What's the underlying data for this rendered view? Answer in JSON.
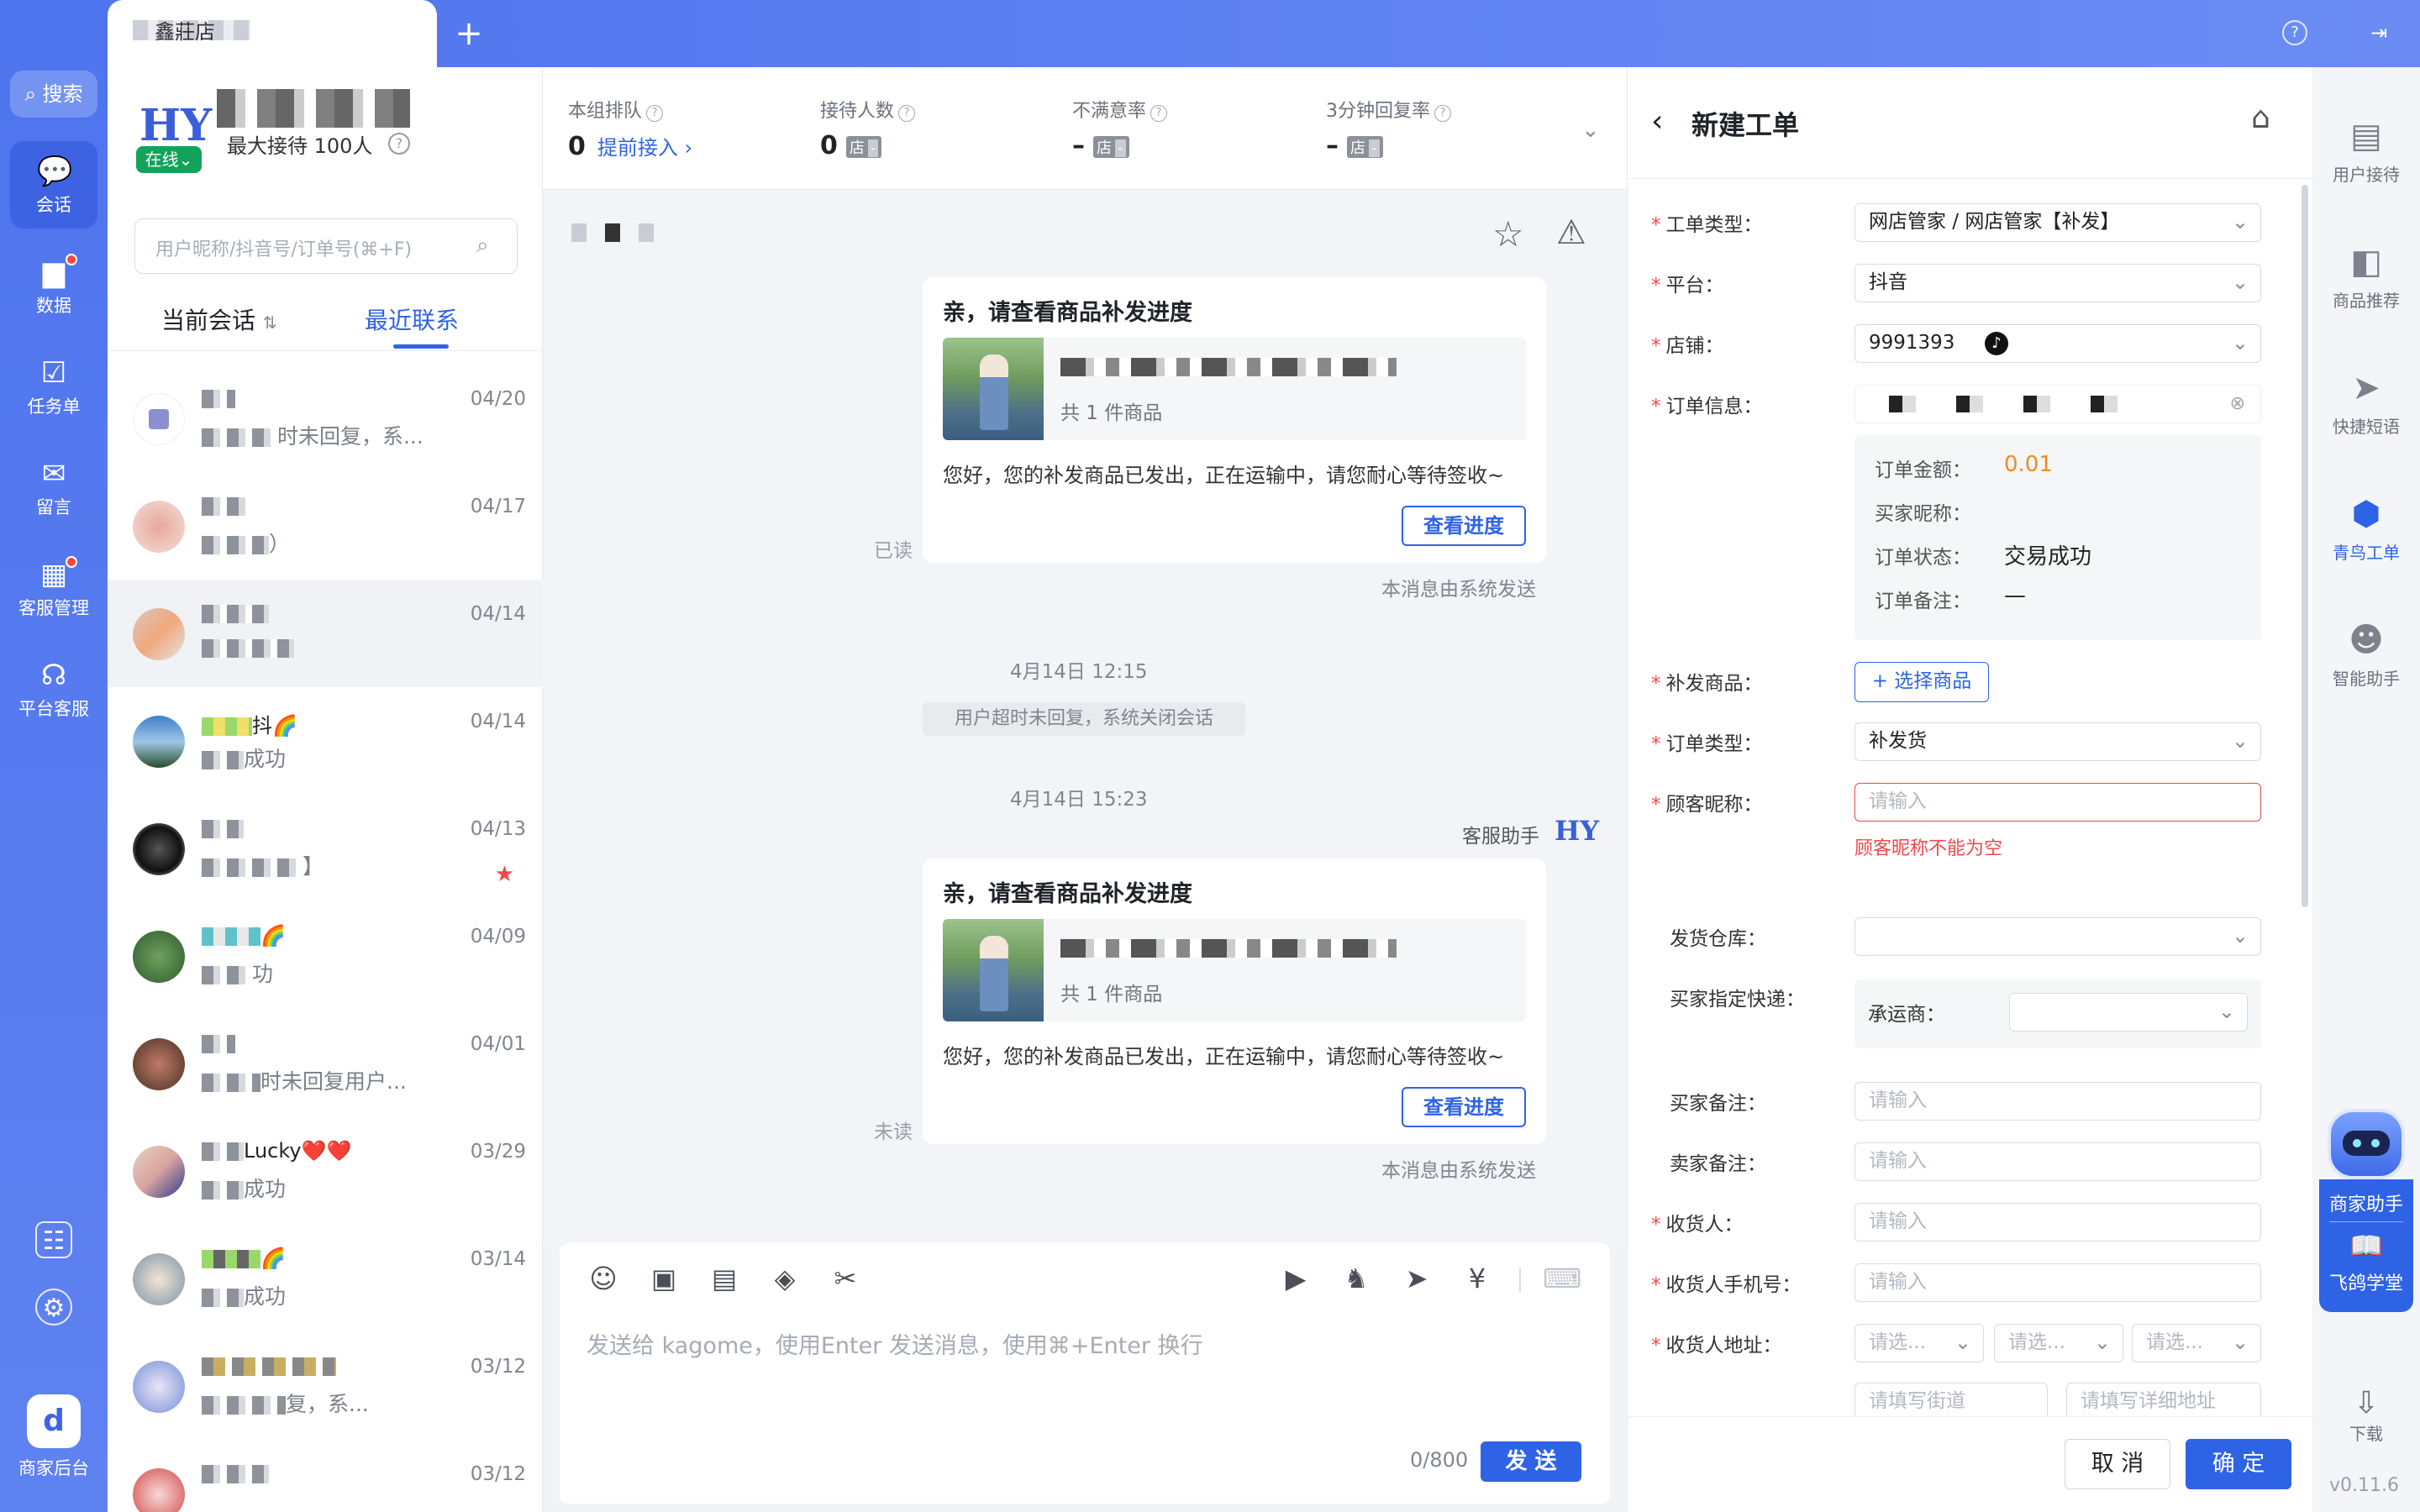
{
  "top_bar": {
    "active_tab_label": "鑫莊店",
    "add_tab_label": "+",
    "help_label": "?"
  },
  "left_nav": {
    "search_label": "搜索",
    "items": [
      {
        "label": "会话",
        "icon": "chat-icon",
        "active": true
      },
      {
        "label": "数据",
        "icon": "bar-chart-icon",
        "badge": true
      },
      {
        "label": "任务单",
        "icon": "task-icon"
      },
      {
        "label": "留言",
        "icon": "mail-icon"
      },
      {
        "label": "客服管理",
        "icon": "apps-icon",
        "badge": true
      },
      {
        "label": "平台客服",
        "icon": "headset-icon"
      }
    ],
    "bottom_label": "商家后台"
  },
  "agent": {
    "status": "在线",
    "max_reception": "最大接待 100人"
  },
  "conv_list": {
    "search_placeholder": "用户昵称/抖音号/订单号(⌘+F)",
    "tab_current": "当前会话",
    "tab_recent": "最近联系",
    "rows": [
      {
        "name": "",
        "preview": "时未回复，系...",
        "date": "04/20"
      },
      {
        "name": "",
        "preview": "）",
        "date": "04/17"
      },
      {
        "name": "",
        "preview": "",
        "date": "04/14",
        "selected": true
      },
      {
        "name": "抖🌈",
        "preview": "成功",
        "date": "04/14"
      },
      {
        "name": "",
        "preview": "】",
        "date": "04/13",
        "flag": true
      },
      {
        "name": "🌈",
        "preview": "功",
        "date": "04/09"
      },
      {
        "name": "",
        "preview": "时未回复用户...",
        "date": "04/01"
      },
      {
        "name": "Lucky❤️❤️",
        "preview": "成功",
        "date": "03/29"
      },
      {
        "name": "🌈",
        "preview": "成功",
        "date": "03/14"
      },
      {
        "name": "",
        "preview": "复，系...",
        "date": "03/12"
      },
      {
        "name": "",
        "preview": "",
        "date": "03/12"
      }
    ]
  },
  "stats": [
    {
      "label": "本组排队",
      "value": "0",
      "link": "提前接入 ›"
    },
    {
      "label": "接待人数",
      "value": "0",
      "badge": "店",
      "badge_d": "-"
    },
    {
      "label": "不满意率",
      "value": "–",
      "badge": "店",
      "badge_d": "-"
    },
    {
      "label": "3分钟回复率",
      "value": "–",
      "badge": "店",
      "badge_d": "-"
    }
  ],
  "chat": {
    "messages": [
      {
        "title": "亲，请查看商品补发进度",
        "count": "共 1 件商品",
        "body": "您好，您的补发商品已发出，正在运输中，请您耐心等待签收~",
        "button": "查看进度",
        "read_state": "已读",
        "sys_note": "本消息由系统发送"
      },
      {
        "title": "亲，请查看商品补发进度",
        "count": "共 1 件商品",
        "body": "您好，您的补发商品已发出，正在运输中，请您耐心等待签收~",
        "button": "查看进度",
        "read_state": "未读",
        "sys_note": "本消息由系统发送"
      }
    ],
    "time1": "4月14日 12:15",
    "system_closed": "用户超时未回复，系统关闭会话",
    "time2": "4月14日 15:23",
    "assistant_label": "客服助手"
  },
  "composer": {
    "placeholder": "发送给 kagome，使用Enter 发送消息，使用⌘+Enter 换行",
    "char_count": "0/800",
    "send": "发 送"
  },
  "work_order": {
    "title": "新建工单",
    "fields": {
      "type_label": "工单类型：",
      "type_value": "网店管家 / 网店管家【补发】",
      "platform_label": "平台：",
      "platform_value": "抖音",
      "shop_label": "店铺：",
      "shop_value": "9991393",
      "order_label": "订单信息：",
      "amount_label": "订单金额：",
      "amount_value": "0.01",
      "buyer_label": "买家昵称：",
      "buyer_value": "",
      "status_label": "订单状态：",
      "status_value": "交易成功",
      "remark_label": "订单备注：",
      "remark_value": "—",
      "reissue_label": "补发商品：",
      "reissue_button": "+ 选择商品",
      "order_type_label": "订单类型：",
      "order_type_value": "补发货",
      "customer_nick_label": "顾客昵称：",
      "customer_nick_placeholder": "请输入",
      "customer_nick_error": "顾客昵称不能为空",
      "warehouse_label": "发货仓库：",
      "express_label": "买家指定快递：",
      "carrier_label": "承运商：",
      "buyer_note_label": "买家备注：",
      "buyer_note_placeholder": "请输入",
      "seller_note_label": "卖家备注：",
      "seller_note_placeholder": "请输入",
      "receiver_label": "收货人：",
      "receiver_placeholder": "请输入",
      "phone_label": "收货人手机号：",
      "phone_placeholder": "请输入",
      "address_label": "收货人地址：",
      "addr_select_1": "请选...",
      "addr_select_2": "请选...",
      "addr_select_3": "请选...",
      "street_placeholder": "请填写街道",
      "detail_placeholder": "请填写详细地址"
    },
    "cancel": "取 消",
    "confirm": "确 定"
  },
  "right_bar": {
    "items": [
      {
        "label": "用户接待",
        "icon": "user-reception-icon"
      },
      {
        "label": "商品推荐",
        "icon": "product-icon"
      },
      {
        "label": "快捷短语",
        "icon": "send-icon"
      },
      {
        "label": "青鸟工单",
        "icon": "cube-icon",
        "active": true
      },
      {
        "label": "智能助手",
        "icon": "robot-icon"
      }
    ],
    "assistant_label": "商家助手",
    "school_label": "飞鸽学堂",
    "download_label": "下载",
    "version": "v0.11.6"
  },
  "colors": {
    "primary": "#2f63e6",
    "nav_bg": "#4e74ee",
    "error": "#f2484b",
    "amount": "#f08a24"
  }
}
